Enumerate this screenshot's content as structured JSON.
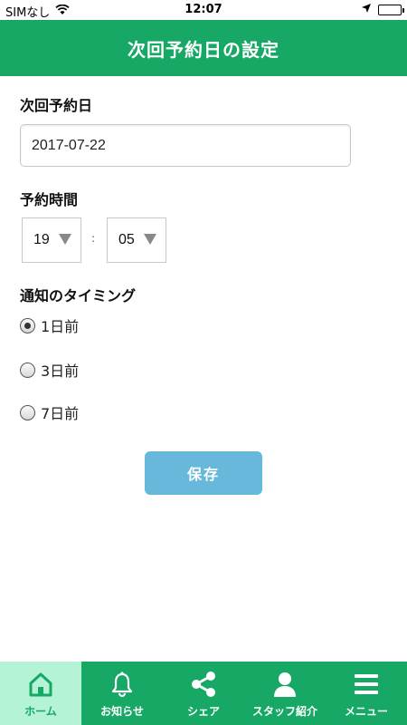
{
  "status_bar": {
    "carrier": "SIMなし",
    "time": "12:07"
  },
  "header": {
    "title": "次回予約日の設定"
  },
  "next_date": {
    "label": "次回予約日",
    "value": "2017-07-22"
  },
  "time": {
    "label": "予約時間",
    "hour": "19",
    "separator": ":",
    "minute": "05"
  },
  "notify": {
    "label": "通知のタイミング",
    "options": [
      {
        "label": "1日前",
        "checked": true
      },
      {
        "label": "3日前",
        "checked": false
      },
      {
        "label": "7日前",
        "checked": false
      }
    ]
  },
  "save_label": "保存",
  "tabs": [
    {
      "label": "ホーム",
      "icon": "home-icon",
      "active": true
    },
    {
      "label": "お知らせ",
      "icon": "bell-icon",
      "active": false
    },
    {
      "label": "シェア",
      "icon": "share-icon",
      "active": false
    },
    {
      "label": "スタッフ紹介",
      "icon": "person-icon",
      "active": false
    },
    {
      "label": "メニュー",
      "icon": "menu-icon",
      "active": false
    }
  ],
  "colors": {
    "brand_green": "#17a865",
    "active_tab_bg": "#b5f3d6",
    "save_button": "#68b8dc"
  }
}
